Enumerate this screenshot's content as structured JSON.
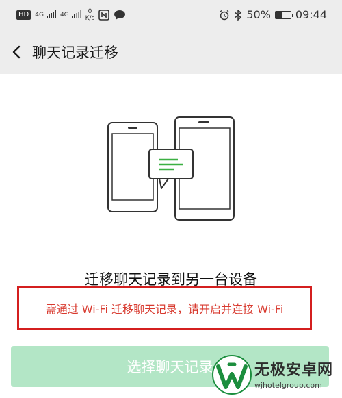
{
  "status_bar": {
    "hd_label": "HD",
    "sim1_label": "4G",
    "sim2_label": "4G",
    "net_speed_value": "0",
    "net_speed_unit": "K/s",
    "battery_percent_label": "50%",
    "battery_level": 0.5,
    "time": "09:44",
    "icons": [
      "hd-icon",
      "signal-icon",
      "nfc-icon",
      "chat-bubble-icon",
      "alarm-icon",
      "bluetooth-icon",
      "battery-icon"
    ]
  },
  "nav": {
    "back_icon": "chevron-left-icon",
    "title": "聊天记录迁移"
  },
  "content": {
    "illustration_icon": "phones-transfer-icon",
    "accent_color": "#3cb043",
    "headline": "迁移聊天记录到另一台设备",
    "warning": "需通过 Wi-Fi 迁移聊天记录，请开启并连接 Wi-Fi",
    "warning_border_color": "#d41f1f"
  },
  "primary_button": {
    "label": "选择聊天记录",
    "color": "#b3e6c6"
  },
  "watermark": {
    "name": "无极安卓网",
    "url": "wjhotelgroup.com"
  }
}
